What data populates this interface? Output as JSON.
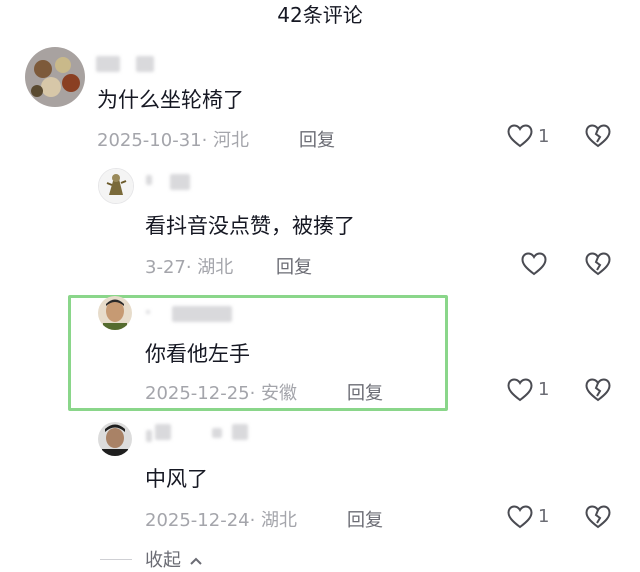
{
  "header": {
    "title": "42条评论"
  },
  "comments": [
    {
      "text": "为什么坐轮椅了",
      "date": "2025-10-31· 河北",
      "reply_label": "回复",
      "likes": "1"
    },
    {
      "text": "看抖音没点赞，被揍了",
      "date": "3-27· 湖北",
      "reply_label": "回复",
      "likes": ""
    },
    {
      "text": "你看他左手",
      "date": "2025-12-25· 安徽",
      "reply_label": "回复",
      "likes": "1"
    },
    {
      "text": "中风了",
      "date": "2025-12-24· 湖北",
      "reply_label": "回复",
      "likes": "1"
    }
  ],
  "collapse_label": "收起",
  "colors": {
    "highlight_border": "#8ad68a",
    "text": "#161823",
    "muted": "#a4a5ab"
  }
}
